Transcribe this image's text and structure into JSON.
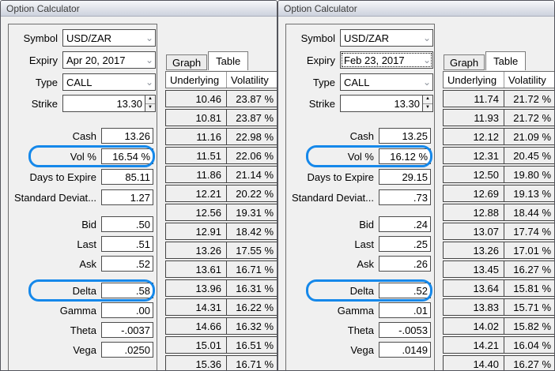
{
  "accent": {
    "highlight_blue": "#1588ea"
  },
  "windows": [
    {
      "title": "Option Calculator",
      "form": {
        "combos": [
          {
            "label": "Symbol",
            "value": "USD/ZAR",
            "focused": false
          },
          {
            "label": "Expiry",
            "value": "Apr 20, 2017",
            "focused": false
          },
          {
            "label": "Type",
            "value": "CALL",
            "focused": false
          }
        ],
        "strike": {
          "label": "Strike",
          "value": "13.30"
        },
        "fields": [
          {
            "label": "Cash",
            "value": "13.26",
            "hl": false,
            "gap": false
          },
          {
            "label": "Vol %",
            "value": "16.54 %",
            "hl": true,
            "gap": false
          },
          {
            "label": "Days to Expire",
            "value": "85.11",
            "hl": false,
            "gap": false
          },
          {
            "label": "Standard Deviat...",
            "value": "1.27",
            "hl": false,
            "gap": false
          },
          {
            "label": "Bid",
            "value": ".50",
            "hl": false,
            "gap": true
          },
          {
            "label": "Last",
            "value": ".51",
            "hl": false,
            "gap": false
          },
          {
            "label": "Ask",
            "value": ".52",
            "hl": false,
            "gap": false
          },
          {
            "label": "Delta",
            "value": ".58",
            "hl": true,
            "gap": true
          },
          {
            "label": "Gamma",
            "value": ".00",
            "hl": false,
            "gap": false
          },
          {
            "label": "Theta",
            "value": "-.0037",
            "hl": false,
            "gap": false
          },
          {
            "label": "Vega",
            "value": ".0250",
            "hl": false,
            "gap": false
          }
        ]
      },
      "tabs": [
        {
          "label": "Graph",
          "active": false
        },
        {
          "label": "Table",
          "active": true
        }
      ],
      "table": {
        "columns": [
          "Underlying",
          "Volatility"
        ],
        "rows": [
          [
            "10.46",
            "23.87 %"
          ],
          [
            "10.81",
            "23.87 %"
          ],
          [
            "11.16",
            "22.98 %"
          ],
          [
            "11.51",
            "22.06 %"
          ],
          [
            "11.86",
            "21.14 %"
          ],
          [
            "12.21",
            "20.22 %"
          ],
          [
            "12.56",
            "19.31 %"
          ],
          [
            "12.91",
            "18.42 %"
          ],
          [
            "13.26",
            "17.55 %"
          ],
          [
            "13.61",
            "16.71 %"
          ],
          [
            "13.96",
            "16.31 %"
          ],
          [
            "14.31",
            "16.22 %"
          ],
          [
            "14.66",
            "16.32 %"
          ],
          [
            "15.01",
            "16.51 %"
          ],
          [
            "15.36",
            "16.71 %"
          ]
        ]
      }
    },
    {
      "title": "Option Calculator",
      "form": {
        "combos": [
          {
            "label": "Symbol",
            "value": "USD/ZAR",
            "focused": false
          },
          {
            "label": "Expiry",
            "value": "Feb 23, 2017",
            "focused": true
          },
          {
            "label": "Type",
            "value": "CALL",
            "focused": false
          }
        ],
        "strike": {
          "label": "Strike",
          "value": "13.30"
        },
        "fields": [
          {
            "label": "Cash",
            "value": "13.25",
            "hl": false,
            "gap": false
          },
          {
            "label": "Vol %",
            "value": "16.12 %",
            "hl": true,
            "gap": false
          },
          {
            "label": "Days to Expire",
            "value": "29.15",
            "hl": false,
            "gap": false
          },
          {
            "label": "Standard Deviat...",
            "value": ".73",
            "hl": false,
            "gap": false
          },
          {
            "label": "Bid",
            "value": ".24",
            "hl": false,
            "gap": true
          },
          {
            "label": "Last",
            "value": ".25",
            "hl": false,
            "gap": false
          },
          {
            "label": "Ask",
            "value": ".26",
            "hl": false,
            "gap": false
          },
          {
            "label": "Delta",
            "value": ".52",
            "hl": true,
            "gap": true
          },
          {
            "label": "Gamma",
            "value": ".01",
            "hl": false,
            "gap": false
          },
          {
            "label": "Theta",
            "value": "-.0053",
            "hl": false,
            "gap": false
          },
          {
            "label": "Vega",
            "value": ".0149",
            "hl": false,
            "gap": false
          }
        ]
      },
      "tabs": [
        {
          "label": "Graph",
          "active": false
        },
        {
          "label": "Table",
          "active": true
        }
      ],
      "table": {
        "columns": [
          "Underlying",
          "Volatility"
        ],
        "rows": [
          [
            "11.74",
            "21.72 %"
          ],
          [
            "11.93",
            "21.72 %"
          ],
          [
            "12.12",
            "21.09 %"
          ],
          [
            "12.31",
            "20.45 %"
          ],
          [
            "12.50",
            "19.80 %"
          ],
          [
            "12.69",
            "19.13 %"
          ],
          [
            "12.88",
            "18.44 %"
          ],
          [
            "13.07",
            "17.74 %"
          ],
          [
            "13.26",
            "17.01 %"
          ],
          [
            "13.45",
            "16.27 %"
          ],
          [
            "13.64",
            "15.81 %"
          ],
          [
            "13.83",
            "15.71 %"
          ],
          [
            "14.02",
            "15.82 %"
          ],
          [
            "14.21",
            "16.04 %"
          ],
          [
            "14.40",
            "16.27 %"
          ]
        ]
      }
    }
  ]
}
